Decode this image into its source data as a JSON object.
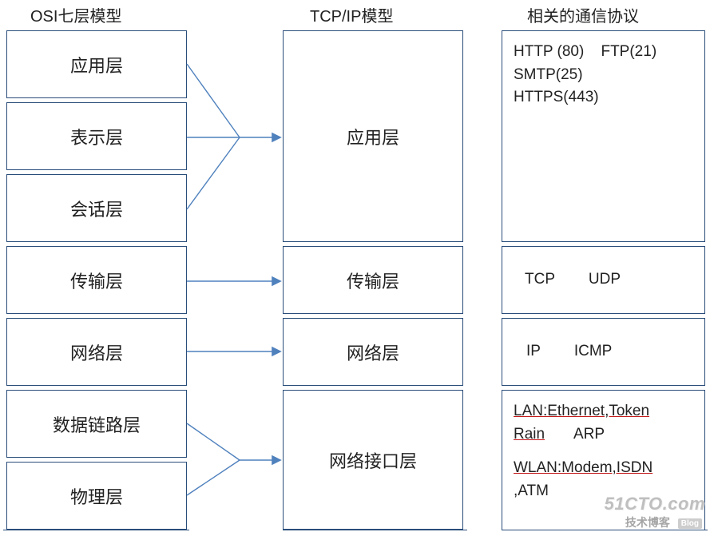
{
  "titles": {
    "osi": "OSI七层模型",
    "tcpip": "TCP/IP模型",
    "proto": "相关的通信协议"
  },
  "osi": {
    "l7": "应用层",
    "l6": "表示层",
    "l5": "会话层",
    "l4": "传输层",
    "l3": "网络层",
    "l2": "数据链路层",
    "l1": "物理层"
  },
  "tcpip": {
    "app": "应用层",
    "trans": "传输层",
    "net": "网络层",
    "link": "网络接口层"
  },
  "protocols": {
    "app": {
      "line1a": "HTTP (80)",
      "line1b": "FTP(21)",
      "line2": "SMTP(25)",
      "line3": "HTTPS(443)"
    },
    "trans": {
      "a": "TCP",
      "b": "UDP"
    },
    "net": {
      "a": "IP",
      "b": "ICMP"
    },
    "link": {
      "lan_a": "LAN:Ethernet,Token",
      "lan_b": "Rain",
      "arp": "ARP",
      "wlan_a": "WLAN:Modem,ISDN",
      "wlan_b": ",ATM"
    }
  },
  "watermark": {
    "site": "51CTO.com",
    "sub": "技术博客",
    "tag": "Blog"
  }
}
